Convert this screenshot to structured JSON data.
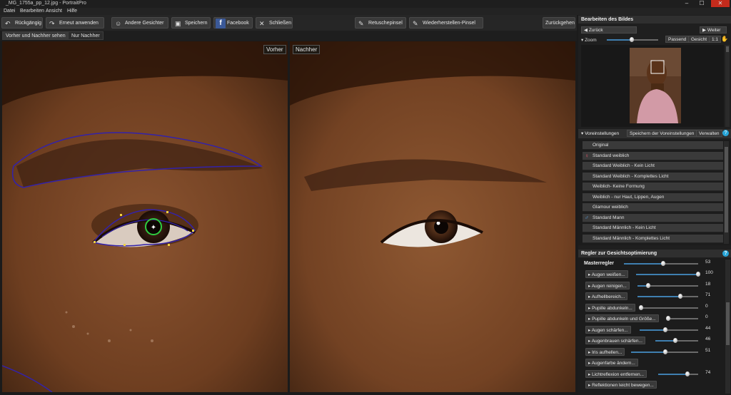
{
  "window": {
    "title": "_MG_1755a_pp_12.jpg - PortraitPro",
    "min": "–",
    "max": "☐",
    "close": "✕"
  },
  "menu": [
    "Datei",
    "Bearbeiten",
    "Ansicht",
    "Hilfe"
  ],
  "toolbar": {
    "undo": "Rückgängig",
    "redo": "Erneut anwenden",
    "other_faces": "Andere Gesichter",
    "save": "Speichern",
    "facebook": "Facebook",
    "close": "Schließen",
    "retouch": "Retuschepinsel",
    "restore": "Wiederherstellen-Pinsel",
    "back": "Zurückgehen"
  },
  "tabs": [
    "Vorher und Nachher sehen",
    "Nur Nachher"
  ],
  "labels": {
    "before": "Vorher",
    "after": "Nachher"
  },
  "edit_panel": {
    "title": "Bearbeiten des Bildes",
    "back": "Zurück",
    "forward": "Weiter",
    "zoom": "Zoom",
    "fit": "Passend",
    "face": "Gesicht",
    "one_to_one": "1:1",
    "zoom_level": 0.48
  },
  "presets_panel": {
    "header": "Voreinstellungen",
    "save": "Speichern der Voreinstellungen",
    "manage": "Verwalten",
    "items": [
      {
        "label": "Original",
        "icon": ""
      },
      {
        "label": "Standard weiblich",
        "icon": "♀"
      },
      {
        "label": "Standard Weiblich - Kein Licht",
        "icon": ""
      },
      {
        "label": "Standard Weiblich - Komplettes Licht",
        "icon": ""
      },
      {
        "label": "Weiblich- Keine Formung",
        "icon": ""
      },
      {
        "label": "Weiblich - nur Haut, Lippen, Augen",
        "icon": ""
      },
      {
        "label": "Glamour weiblich",
        "icon": ""
      },
      {
        "label": "Standard Mann",
        "icon": "♂"
      },
      {
        "label": "Standard Männlich - Kein Licht",
        "icon": ""
      },
      {
        "label": "Standard Männlich - Komplettes Licht",
        "icon": ""
      }
    ]
  },
  "sliders_panel": {
    "title": "Regler zur Gesichtsoptimierung",
    "master": {
      "label": "Masterregler",
      "value": "53",
      "level": 0.53
    },
    "items": [
      {
        "label": "Augen weißen...",
        "value": "100",
        "level": 1.0,
        "start": 75
      },
      {
        "label": "Augen reinigen...",
        "value": "18",
        "level": 0.18,
        "start": 77
      },
      {
        "label": "Aufhellbereich...",
        "value": "71",
        "level": 0.71,
        "start": 77
      },
      {
        "label": "Pupille abdunkeln...",
        "value": "0",
        "level": 0.0,
        "start": 82
      },
      {
        "label": "Pupille abdunkeln und Größe...",
        "value": "0",
        "level": 0.0,
        "start": 120
      },
      {
        "label": "Augen schärfen...",
        "value": "44",
        "level": 0.44,
        "start": 80
      },
      {
        "label": "Augenbrauen schärfen...",
        "value": "46",
        "level": 0.46,
        "start": 102
      },
      {
        "label": "Iris aufhellen...",
        "value": "51",
        "level": 0.51,
        "start": 68
      },
      {
        "label": "Augenfarbe ändern...",
        "value": "",
        "level": null,
        "start": 0
      },
      {
        "label": "Lichtreflexion entfernen...",
        "value": "74",
        "level": 0.74,
        "start": 106
      },
      {
        "label": "Reflektionen leicht bewegen...",
        "value": "",
        "level": null,
        "start": 0
      }
    ]
  }
}
